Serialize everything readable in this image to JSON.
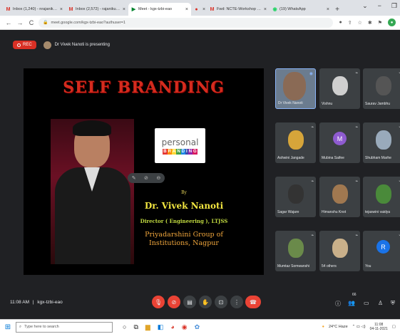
{
  "browser": {
    "tabs": [
      {
        "icon": "M",
        "icon_color": "#d93025",
        "title": "Inbox (1,240) - nrajanikumar",
        "active": false
      },
      {
        "icon": "M",
        "icon_color": "#d93025",
        "title": "Inbox (2,572) - rajanikumar",
        "active": false
      },
      {
        "icon": "▶",
        "icon_color": "#00832d",
        "title": "Meet - kgx-tzbi-eao",
        "active": true
      },
      {
        "icon": "●",
        "icon_color": "#d93025",
        "title": "",
        "active": false
      },
      {
        "icon": "M",
        "icon_color": "#d93025",
        "title": "Fwd: NCTE-Workshop on S",
        "active": false
      },
      {
        "icon": "◉",
        "icon_color": "#25d366",
        "title": "(19) WhatsApp",
        "active": false
      }
    ],
    "new_tab_label": "+",
    "url": "meet.google.com/kgx-tzbi-eao?authuser=1",
    "window_controls": [
      "⌄",
      "−",
      "❐"
    ]
  },
  "meet": {
    "rec_label": "REC",
    "presenting_text": "Dr Vivek Nanoti is presenting",
    "slide": {
      "title": "SELF BRANDING",
      "brand_word1": "personal",
      "brand_word2": [
        "B",
        "R",
        "A",
        "N",
        "D",
        "I",
        "N",
        "G"
      ],
      "by": "By",
      "name": "Dr. Vivek Nanoti",
      "role": "Director ( Engineering ), LTJSS",
      "org": "Priyadarshini Group of Institutions, Nagpur"
    },
    "participants": [
      {
        "name": "Dr Vivek Nanoti",
        "kind": "photo",
        "color": "#8a6a55",
        "active": true
      },
      {
        "name": "Vishnu",
        "kind": "photo",
        "color": "#cfcfcf",
        "active": false
      },
      {
        "name": "Saurav Jambhu",
        "kind": "photo",
        "color": "#555",
        "active": false
      },
      {
        "name": "Ashwini Jangade",
        "kind": "photo",
        "color": "#d6a53a",
        "active": false
      },
      {
        "name": "Mubina Saifee",
        "kind": "letter",
        "letter": "M",
        "color": "#8e5bd0",
        "active": false
      },
      {
        "name": "Shubham Marhe",
        "kind": "photo",
        "color": "#9ab",
        "active": false
      },
      {
        "name": "Sagar Wajare",
        "kind": "photo",
        "color": "#333",
        "active": false
      },
      {
        "name": "Himanshu Knot",
        "kind": "photo",
        "color": "#a07850",
        "active": false
      },
      {
        "name": "tejaswini vaidya",
        "kind": "photo",
        "color": "#4a8a3a",
        "active": false
      },
      {
        "name": "Mumtaz Somwanshi",
        "kind": "photo",
        "color": "#6a8a4a",
        "active": false
      },
      {
        "name": "54 others",
        "kind": "group",
        "color": "#c9b08a",
        "active": false
      },
      {
        "name": "You",
        "kind": "letter",
        "letter": "R",
        "color": "#1a73e8",
        "active": false
      }
    ],
    "time": "11:08 AM",
    "separator": "|",
    "meeting_code": "kgx-tzbi-eao",
    "participant_count": "66"
  },
  "taskbar": {
    "search_placeholder": "Type here to search",
    "weather": "24°C Haze",
    "clock_time": "11:08",
    "clock_date": "04-11-2021"
  },
  "colors": {
    "meet_bg": "#202124",
    "tile_bg": "#3c4043",
    "red": "#ea4335",
    "title_red": "#d42b1e"
  }
}
